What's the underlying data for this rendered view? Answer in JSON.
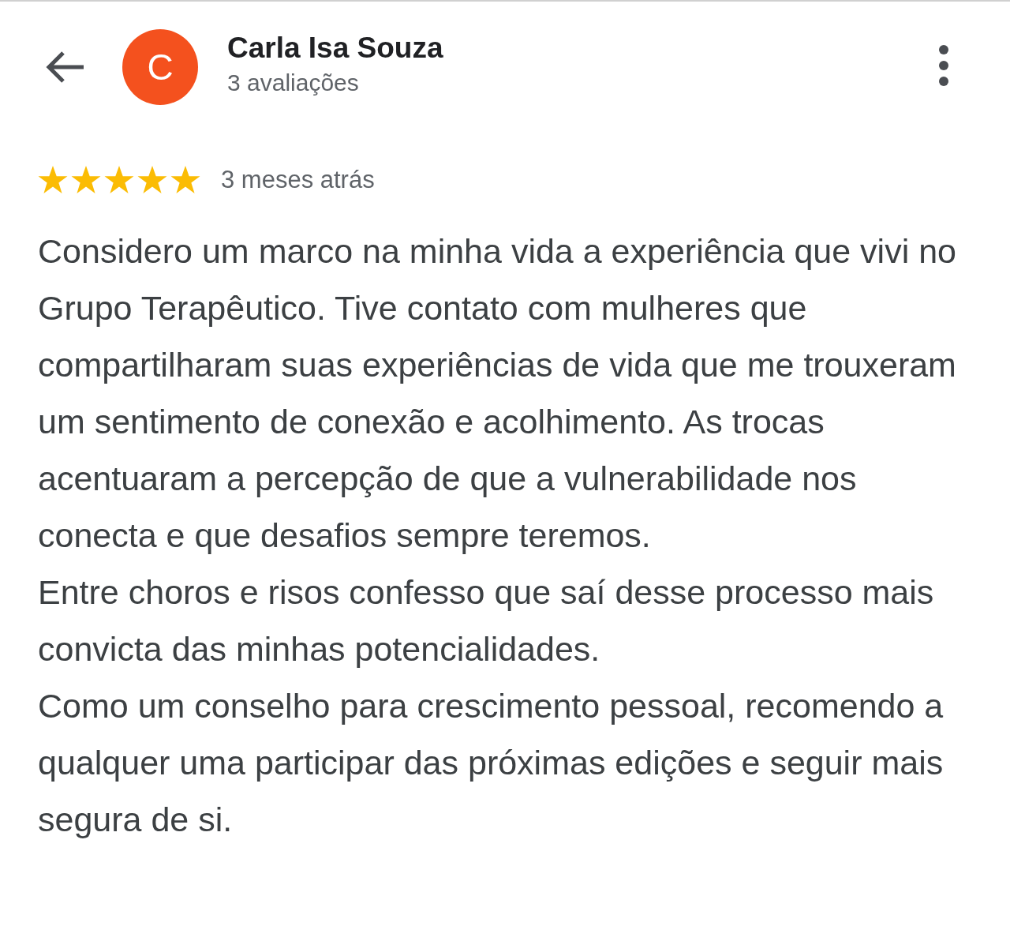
{
  "reviewer": {
    "avatar_letter": "C",
    "name": "Carla Isa Souza",
    "review_count": "3 avaliações"
  },
  "review": {
    "stars": 5,
    "time": "3 meses atrás",
    "paragraphs": [
      "Considero um marco na minha vida a experiência que vivi no Grupo Terapêutico. Tive contato com mulheres que compartilharam suas experiências de vida que me trouxeram um sentimento de conexão e acolhimento. As trocas acentuaram a percepção de que a vulnerabilidade nos conecta e que desafios sempre teremos.",
      "Entre choros e risos confesso que saí desse processo mais convicta das minhas potencialidades.",
      "Como um conselho para crescimento pessoal, recomendo a qualquer uma participar das próximas edições e seguir mais segura de si."
    ]
  }
}
